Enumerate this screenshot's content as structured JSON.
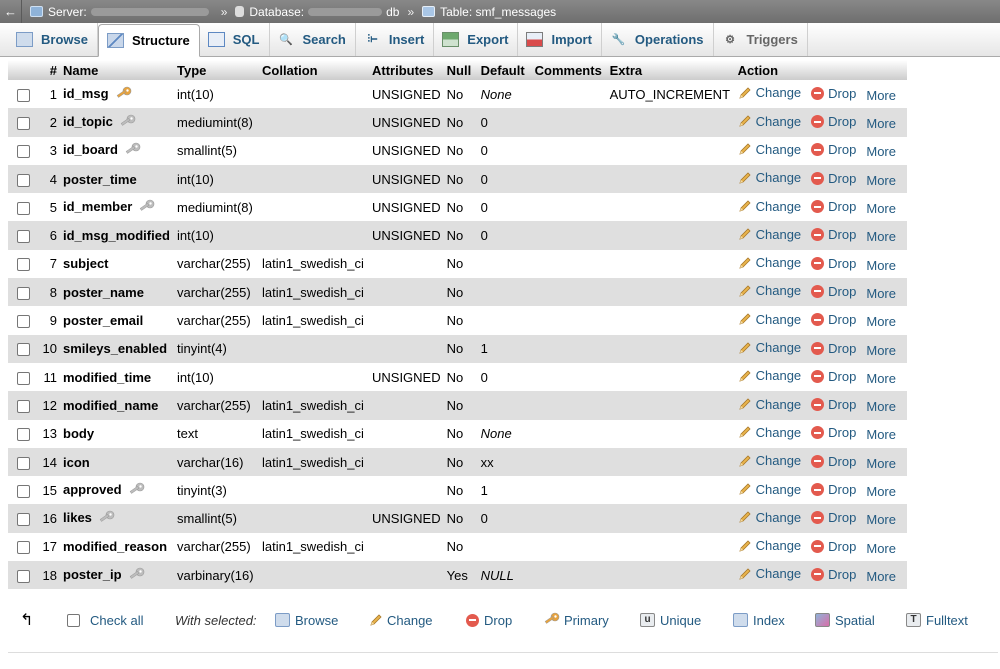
{
  "breadcrumb": {
    "server_label": "Server:",
    "database_label": "Database:",
    "database_suffix": "db",
    "table_label": "Table: smf_messages",
    "sep": "»"
  },
  "tabs": [
    {
      "label": "Browse",
      "icon": "browse-icon"
    },
    {
      "label": "Structure",
      "icon": "structure-icon"
    },
    {
      "label": "SQL",
      "icon": "sql-icon"
    },
    {
      "label": "Search",
      "icon": "search-icon"
    },
    {
      "label": "Insert",
      "icon": "insert-icon"
    },
    {
      "label": "Export",
      "icon": "export-icon"
    },
    {
      "label": "Import",
      "icon": "import-icon"
    },
    {
      "label": "Operations",
      "icon": "operations-icon"
    },
    {
      "label": "Triggers",
      "icon": "triggers-icon"
    }
  ],
  "columns": [
    "#",
    "Name",
    "Type",
    "Collation",
    "Attributes",
    "Null",
    "Default",
    "Comments",
    "Extra",
    "Action"
  ],
  "actions": {
    "change": "Change",
    "drop": "Drop",
    "more": "More"
  },
  "rows": [
    {
      "n": "1",
      "name": "id_msg",
      "key": "primary",
      "type": "int(10)",
      "collation": "",
      "attributes": "UNSIGNED",
      "null": "No",
      "default": "None",
      "default_italic": true,
      "extra": "AUTO_INCREMENT"
    },
    {
      "n": "2",
      "name": "id_topic",
      "key": "index",
      "type": "mediumint(8)",
      "collation": "",
      "attributes": "UNSIGNED",
      "null": "No",
      "default": "0",
      "extra": ""
    },
    {
      "n": "3",
      "name": "id_board",
      "key": "index",
      "type": "smallint(5)",
      "collation": "",
      "attributes": "UNSIGNED",
      "null": "No",
      "default": "0",
      "extra": ""
    },
    {
      "n": "4",
      "name": "poster_time",
      "key": "",
      "type": "int(10)",
      "collation": "",
      "attributes": "UNSIGNED",
      "null": "No",
      "default": "0",
      "extra": ""
    },
    {
      "n": "5",
      "name": "id_member",
      "key": "index",
      "type": "mediumint(8)",
      "collation": "",
      "attributes": "UNSIGNED",
      "null": "No",
      "default": "0",
      "extra": ""
    },
    {
      "n": "6",
      "name": "id_msg_modified",
      "key": "",
      "type": "int(10)",
      "collation": "",
      "attributes": "UNSIGNED",
      "null": "No",
      "default": "0",
      "extra": ""
    },
    {
      "n": "7",
      "name": "subject",
      "key": "",
      "type": "varchar(255)",
      "collation": "latin1_swedish_ci",
      "attributes": "",
      "null": "No",
      "default": "",
      "extra": ""
    },
    {
      "n": "8",
      "name": "poster_name",
      "key": "",
      "type": "varchar(255)",
      "collation": "latin1_swedish_ci",
      "attributes": "",
      "null": "No",
      "default": "",
      "extra": ""
    },
    {
      "n": "9",
      "name": "poster_email",
      "key": "",
      "type": "varchar(255)",
      "collation": "latin1_swedish_ci",
      "attributes": "",
      "null": "No",
      "default": "",
      "extra": ""
    },
    {
      "n": "10",
      "name": "smileys_enabled",
      "key": "",
      "type": "tinyint(4)",
      "collation": "",
      "attributes": "",
      "null": "No",
      "default": "1",
      "extra": ""
    },
    {
      "n": "11",
      "name": "modified_time",
      "key": "",
      "type": "int(10)",
      "collation": "",
      "attributes": "UNSIGNED",
      "null": "No",
      "default": "0",
      "extra": ""
    },
    {
      "n": "12",
      "name": "modified_name",
      "key": "",
      "type": "varchar(255)",
      "collation": "latin1_swedish_ci",
      "attributes": "",
      "null": "No",
      "default": "",
      "extra": ""
    },
    {
      "n": "13",
      "name": "body",
      "key": "",
      "type": "text",
      "collation": "latin1_swedish_ci",
      "attributes": "",
      "null": "No",
      "default": "None",
      "default_italic": true,
      "extra": ""
    },
    {
      "n": "14",
      "name": "icon",
      "key": "",
      "type": "varchar(16)",
      "collation": "latin1_swedish_ci",
      "attributes": "",
      "null": "No",
      "default": "xx",
      "extra": ""
    },
    {
      "n": "15",
      "name": "approved",
      "key": "index",
      "type": "tinyint(3)",
      "collation": "",
      "attributes": "",
      "null": "No",
      "default": "1",
      "extra": ""
    },
    {
      "n": "16",
      "name": "likes",
      "key": "index",
      "type": "smallint(5)",
      "collation": "",
      "attributes": "UNSIGNED",
      "null": "No",
      "default": "0",
      "extra": ""
    },
    {
      "n": "17",
      "name": "modified_reason",
      "key": "",
      "type": "varchar(255)",
      "collation": "latin1_swedish_ci",
      "attributes": "",
      "null": "No",
      "default": "",
      "extra": ""
    },
    {
      "n": "18",
      "name": "poster_ip",
      "key": "index",
      "type": "varbinary(16)",
      "collation": "",
      "attributes": "",
      "null": "Yes",
      "default": "NULL",
      "default_italic": true,
      "extra": ""
    }
  ],
  "footer": {
    "check_all": "Check all",
    "with_selected": "With selected:",
    "buttons": [
      {
        "label": "Browse",
        "icon": "browse-icon"
      },
      {
        "label": "Change",
        "icon": "pencil-icon"
      },
      {
        "label": "Drop",
        "icon": "drop-icon"
      },
      {
        "label": "Primary",
        "icon": "primary-key-icon"
      },
      {
        "label": "Unique",
        "icon": "unique-icon"
      },
      {
        "label": "Index",
        "icon": "index-icon"
      },
      {
        "label": "Spatial",
        "icon": "spatial-icon"
      },
      {
        "label": "Fulltext",
        "icon": "fulltext-icon"
      }
    ]
  },
  "colors": {
    "link": "#235a81",
    "primary_key": "#e8a33d",
    "index_key": "#bdbdbd",
    "drop": "#e35a4e",
    "row_alt": "#dfdfdf"
  }
}
